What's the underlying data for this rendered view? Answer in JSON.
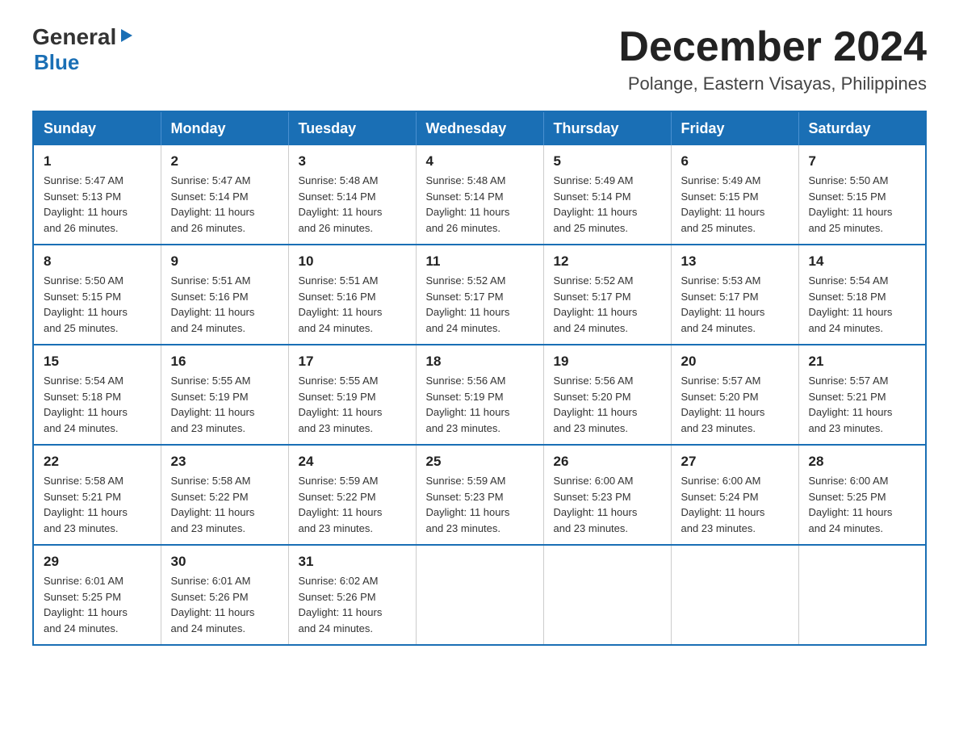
{
  "header": {
    "logo_general": "General",
    "logo_blue": "Blue",
    "month_title": "December 2024",
    "location": "Polange, Eastern Visayas, Philippines"
  },
  "days_of_week": [
    "Sunday",
    "Monday",
    "Tuesday",
    "Wednesday",
    "Thursday",
    "Friday",
    "Saturday"
  ],
  "weeks": [
    [
      {
        "day": "1",
        "sunrise": "5:47 AM",
        "sunset": "5:13 PM",
        "daylight": "11 hours and 26 minutes."
      },
      {
        "day": "2",
        "sunrise": "5:47 AM",
        "sunset": "5:14 PM",
        "daylight": "11 hours and 26 minutes."
      },
      {
        "day": "3",
        "sunrise": "5:48 AM",
        "sunset": "5:14 PM",
        "daylight": "11 hours and 26 minutes."
      },
      {
        "day": "4",
        "sunrise": "5:48 AM",
        "sunset": "5:14 PM",
        "daylight": "11 hours and 26 minutes."
      },
      {
        "day": "5",
        "sunrise": "5:49 AM",
        "sunset": "5:14 PM",
        "daylight": "11 hours and 25 minutes."
      },
      {
        "day": "6",
        "sunrise": "5:49 AM",
        "sunset": "5:15 PM",
        "daylight": "11 hours and 25 minutes."
      },
      {
        "day": "7",
        "sunrise": "5:50 AM",
        "sunset": "5:15 PM",
        "daylight": "11 hours and 25 minutes."
      }
    ],
    [
      {
        "day": "8",
        "sunrise": "5:50 AM",
        "sunset": "5:15 PM",
        "daylight": "11 hours and 25 minutes."
      },
      {
        "day": "9",
        "sunrise": "5:51 AM",
        "sunset": "5:16 PM",
        "daylight": "11 hours and 24 minutes."
      },
      {
        "day": "10",
        "sunrise": "5:51 AM",
        "sunset": "5:16 PM",
        "daylight": "11 hours and 24 minutes."
      },
      {
        "day": "11",
        "sunrise": "5:52 AM",
        "sunset": "5:17 PM",
        "daylight": "11 hours and 24 minutes."
      },
      {
        "day": "12",
        "sunrise": "5:52 AM",
        "sunset": "5:17 PM",
        "daylight": "11 hours and 24 minutes."
      },
      {
        "day": "13",
        "sunrise": "5:53 AM",
        "sunset": "5:17 PM",
        "daylight": "11 hours and 24 minutes."
      },
      {
        "day": "14",
        "sunrise": "5:54 AM",
        "sunset": "5:18 PM",
        "daylight": "11 hours and 24 minutes."
      }
    ],
    [
      {
        "day": "15",
        "sunrise": "5:54 AM",
        "sunset": "5:18 PM",
        "daylight": "11 hours and 24 minutes."
      },
      {
        "day": "16",
        "sunrise": "5:55 AM",
        "sunset": "5:19 PM",
        "daylight": "11 hours and 23 minutes."
      },
      {
        "day": "17",
        "sunrise": "5:55 AM",
        "sunset": "5:19 PM",
        "daylight": "11 hours and 23 minutes."
      },
      {
        "day": "18",
        "sunrise": "5:56 AM",
        "sunset": "5:19 PM",
        "daylight": "11 hours and 23 minutes."
      },
      {
        "day": "19",
        "sunrise": "5:56 AM",
        "sunset": "5:20 PM",
        "daylight": "11 hours and 23 minutes."
      },
      {
        "day": "20",
        "sunrise": "5:57 AM",
        "sunset": "5:20 PM",
        "daylight": "11 hours and 23 minutes."
      },
      {
        "day": "21",
        "sunrise": "5:57 AM",
        "sunset": "5:21 PM",
        "daylight": "11 hours and 23 minutes."
      }
    ],
    [
      {
        "day": "22",
        "sunrise": "5:58 AM",
        "sunset": "5:21 PM",
        "daylight": "11 hours and 23 minutes."
      },
      {
        "day": "23",
        "sunrise": "5:58 AM",
        "sunset": "5:22 PM",
        "daylight": "11 hours and 23 minutes."
      },
      {
        "day": "24",
        "sunrise": "5:59 AM",
        "sunset": "5:22 PM",
        "daylight": "11 hours and 23 minutes."
      },
      {
        "day": "25",
        "sunrise": "5:59 AM",
        "sunset": "5:23 PM",
        "daylight": "11 hours and 23 minutes."
      },
      {
        "day": "26",
        "sunrise": "6:00 AM",
        "sunset": "5:23 PM",
        "daylight": "11 hours and 23 minutes."
      },
      {
        "day": "27",
        "sunrise": "6:00 AM",
        "sunset": "5:24 PM",
        "daylight": "11 hours and 23 minutes."
      },
      {
        "day": "28",
        "sunrise": "6:00 AM",
        "sunset": "5:25 PM",
        "daylight": "11 hours and 24 minutes."
      }
    ],
    [
      {
        "day": "29",
        "sunrise": "6:01 AM",
        "sunset": "5:25 PM",
        "daylight": "11 hours and 24 minutes."
      },
      {
        "day": "30",
        "sunrise": "6:01 AM",
        "sunset": "5:26 PM",
        "daylight": "11 hours and 24 minutes."
      },
      {
        "day": "31",
        "sunrise": "6:02 AM",
        "sunset": "5:26 PM",
        "daylight": "11 hours and 24 minutes."
      },
      null,
      null,
      null,
      null
    ]
  ],
  "labels": {
    "sunrise": "Sunrise:",
    "sunset": "Sunset:",
    "daylight": "Daylight:"
  }
}
